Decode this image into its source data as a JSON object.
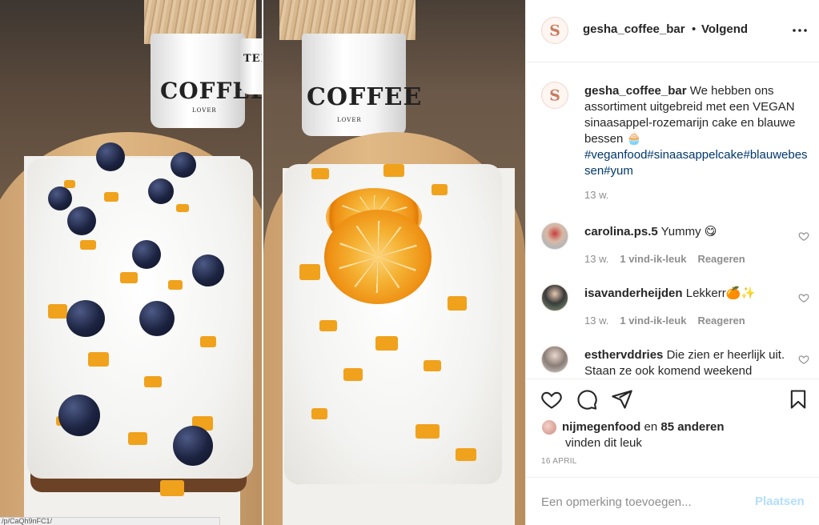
{
  "photo": {
    "alt_icons": [
      "coffee-mug",
      "blueberry",
      "orange-slice"
    ],
    "mug_text": "COFFEE",
    "mug_subtext": "LOVER",
    "mug_text_secondary": "TEN",
    "status_url": "/p/CaQh9nFC1/"
  },
  "header": {
    "username": "gesha_coffee_bar",
    "separator": "•",
    "follow_label": "Volgend",
    "more_icon": "more-horizontal-icon"
  },
  "caption": {
    "username": "gesha_coffee_bar",
    "text": "We hebben ons assortiment uitgebreid met een VEGAN sinaasappel-rozemarijn cake en blauwe bessen 🧁",
    "hashtags": "#veganfood#sinaasappelcake#blauwebessen#yum",
    "time": "13 w."
  },
  "comments": [
    {
      "username": "carolina.ps.5",
      "text": "Yummy 😋",
      "time": "13 w.",
      "likes": "1 vind-ik-leuk",
      "reply": "Reageren"
    },
    {
      "username": "isavanderheijden",
      "text": "Lekkerr🍊✨",
      "time": "13 w.",
      "likes": "1 vind-ik-leuk",
      "reply": "Reageren"
    },
    {
      "username": "esthervddries",
      "text": "Die zien er heerlijk uit. Staan ze ook komend weekend"
    }
  ],
  "actions": {
    "like_icon": "heart-icon",
    "comment_icon": "comment-icon",
    "share_icon": "share-icon",
    "save_icon": "bookmark-icon"
  },
  "likes": {
    "user": "nijmegenfood",
    "middle": " en ",
    "others": "85 anderen",
    "suffix": "vinden dit leuk"
  },
  "date": "16 APRIL",
  "add_comment": {
    "placeholder": "Een opmerking toevoegen...",
    "post_label": "Plaatsen"
  },
  "colors": {
    "accent_link": "#00376b",
    "post_disabled": "#b2dffc",
    "muted_text": "#8e8e8e",
    "border": "#efefef"
  }
}
